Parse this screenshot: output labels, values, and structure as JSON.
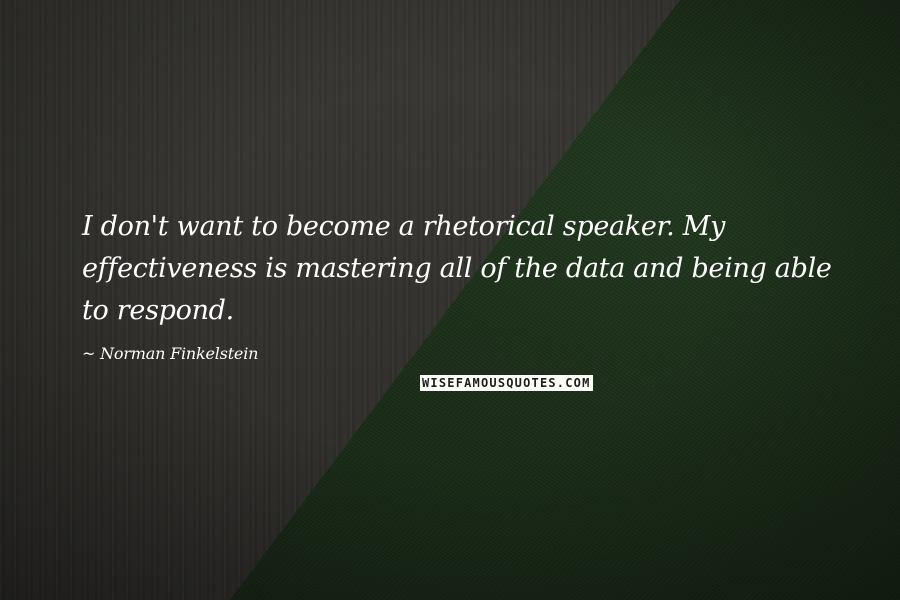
{
  "quote": {
    "text": "I don't want to become a rhetorical speaker. My effectiveness is mastering all of the data and being able to respond."
  },
  "author": {
    "text": "~ Norman Finkelstein"
  },
  "brand": {
    "text": "WISEFAMOUSQUOTES.COM"
  },
  "background": {
    "description": "concrete-wall-and-grass",
    "colors": {
      "wall": "#34332f",
      "grass": "#1b2e18"
    }
  }
}
